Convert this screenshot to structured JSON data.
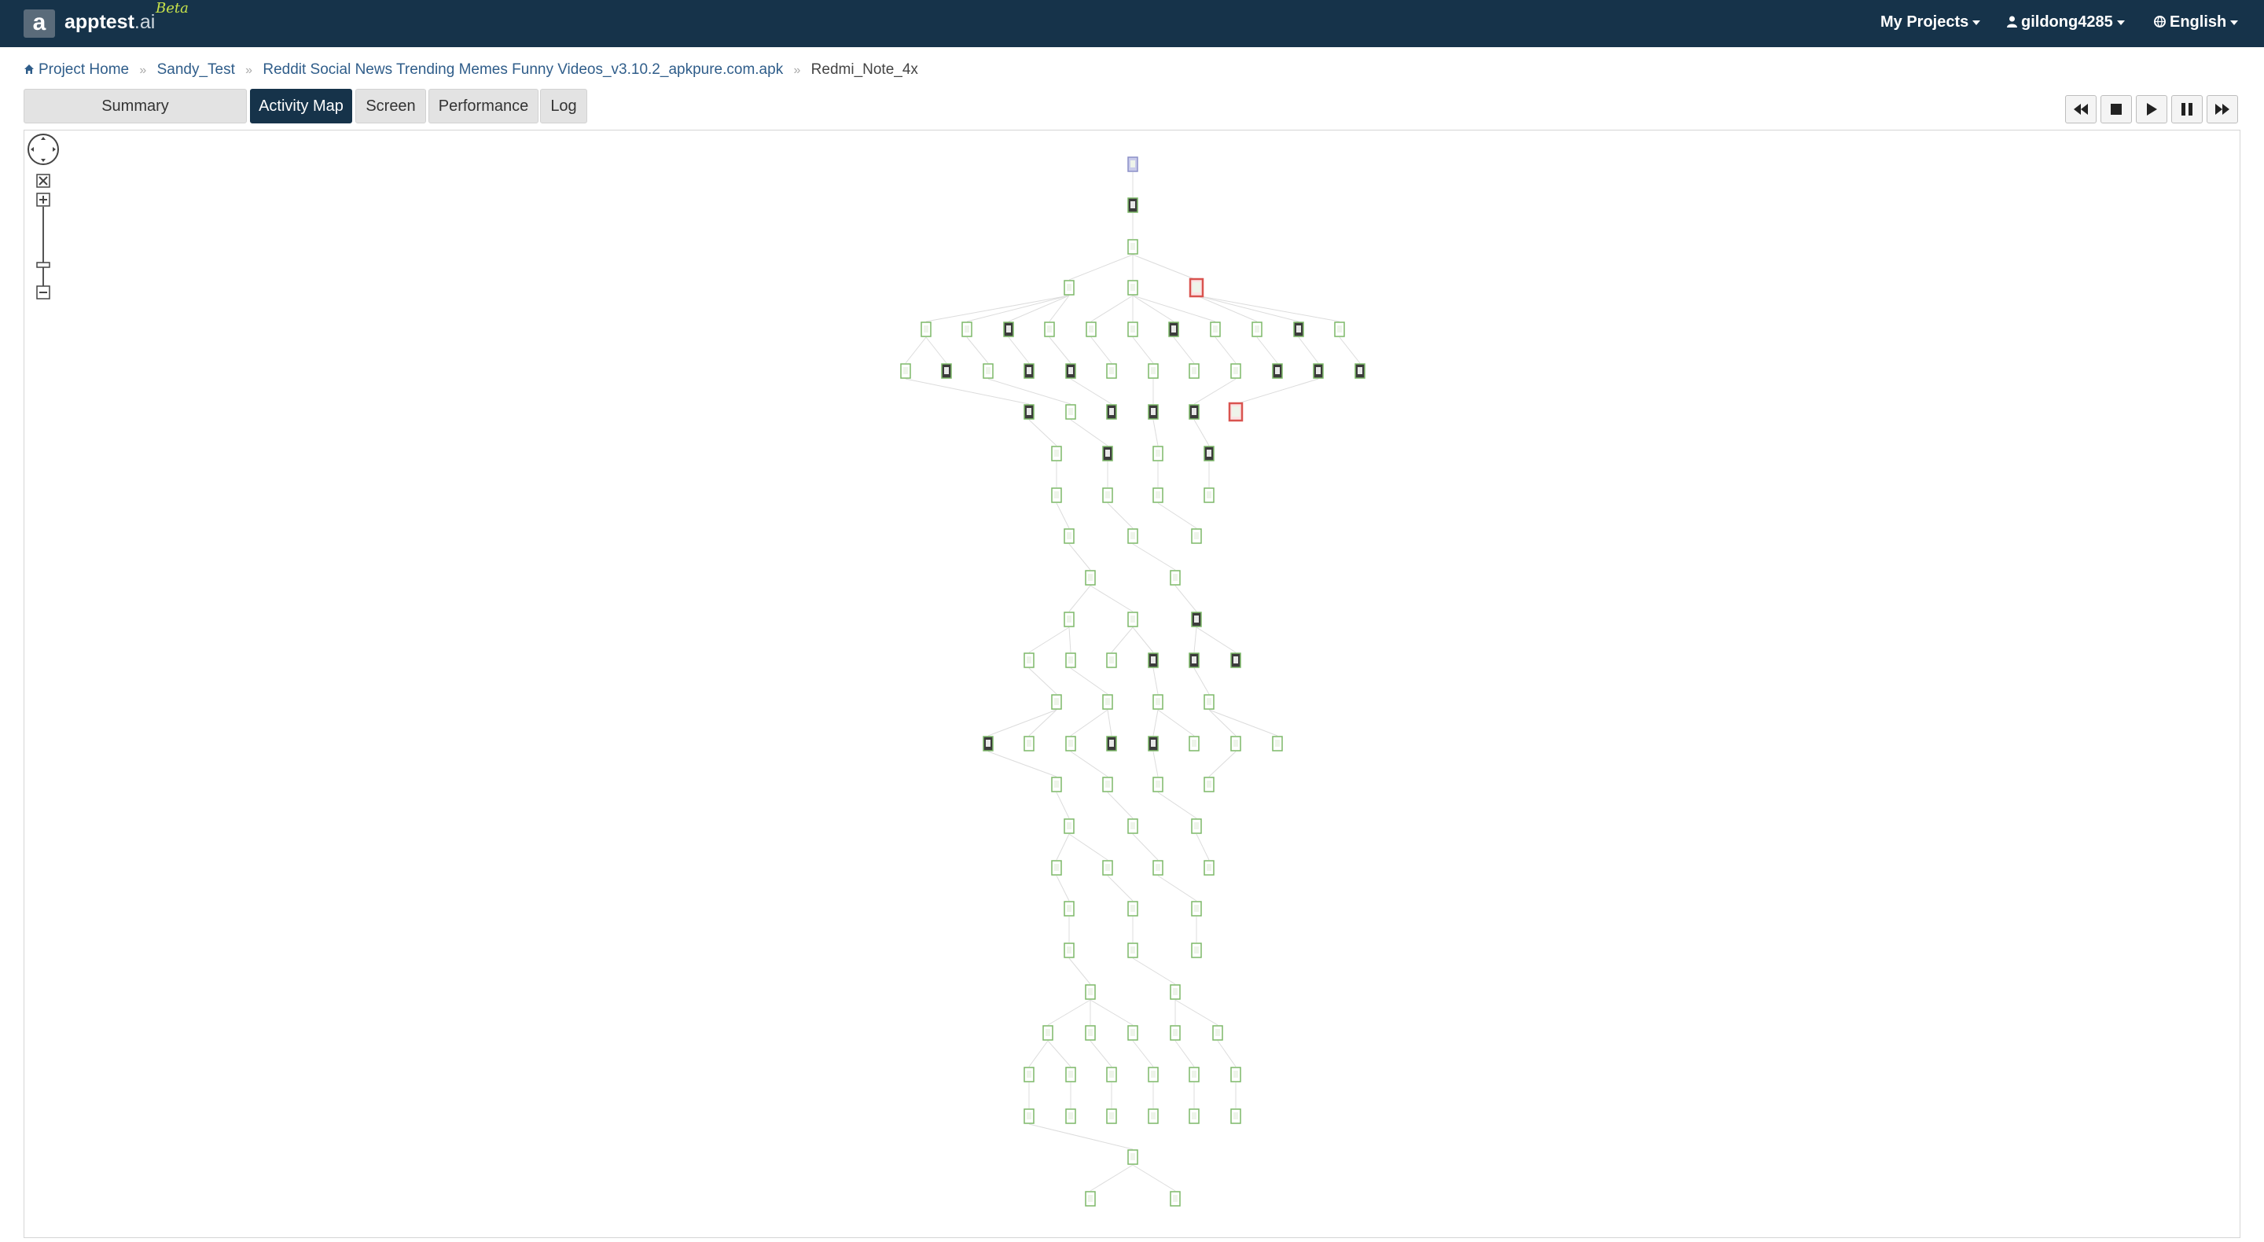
{
  "brand": {
    "logo_letter": "a",
    "name": "apptest",
    "name_suffix": ".ai",
    "badge": "Beta"
  },
  "nav": {
    "projects_label": "My Projects",
    "user_label": "gildong4285",
    "language_label": "English"
  },
  "breadcrumb": {
    "items": [
      "Project Home",
      "Sandy_Test",
      "Reddit Social News Trending Memes Funny Videos_v3.10.2_apkpure.com.apk"
    ],
    "current": "Redmi_Note_4x"
  },
  "tabs": [
    "Summary",
    "Activity Map",
    "Screen",
    "Performance",
    "Log"
  ],
  "active_tab": "Activity Map",
  "playback": [
    "rewind-icon",
    "stop-icon",
    "play-icon",
    "pause-icon",
    "fast-forward-icon"
  ],
  "colors": {
    "navbar": "#16334a",
    "active_tab": "#16334a",
    "link": "#2f5d8a",
    "node_border": "#7db968",
    "node_highlight": "#d9534f",
    "beta": "#c8e34a"
  }
}
